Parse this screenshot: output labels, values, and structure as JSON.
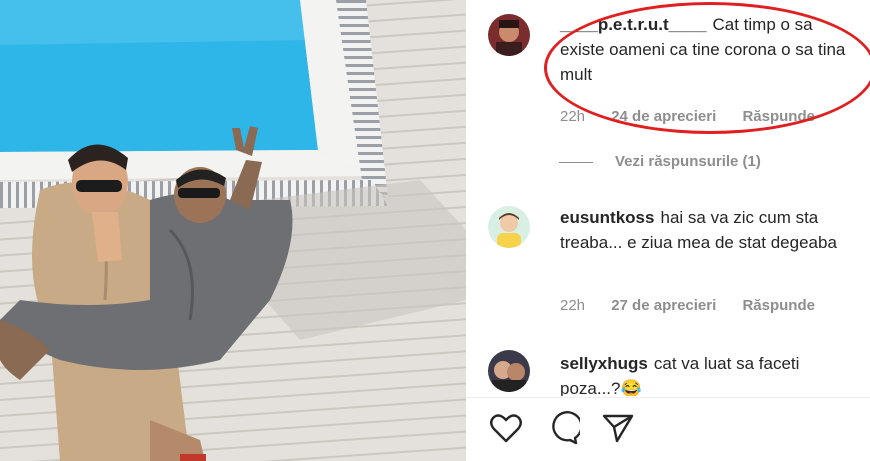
{
  "comments": [
    {
      "username": "____p.e.t.r.u.t____",
      "text": "Cat timp o sa existe oameni ca tine corona o sa tina mult",
      "time": "22h",
      "likes": "24 de aprecieri",
      "reply": "Răspunde"
    },
    {
      "username": "eusuntkoss",
      "text": "hai sa va zic cum sta treaba... e ziua mea de stat degeaba",
      "time": "22h",
      "likes": "27 de aprecieri",
      "reply": "Răspunde"
    },
    {
      "username": "sellyxhugs",
      "text": "cat va luat sa faceti poza...?😂"
    }
  ],
  "view_replies": "Vezi răspunsurile (1)",
  "actions": [
    "heart-icon",
    "comment-icon",
    "share-icon"
  ],
  "colors": {
    "highlight": "#e02020",
    "muted": "#8e8e8e",
    "text": "#262626",
    "pool": "#2fb6e8"
  }
}
